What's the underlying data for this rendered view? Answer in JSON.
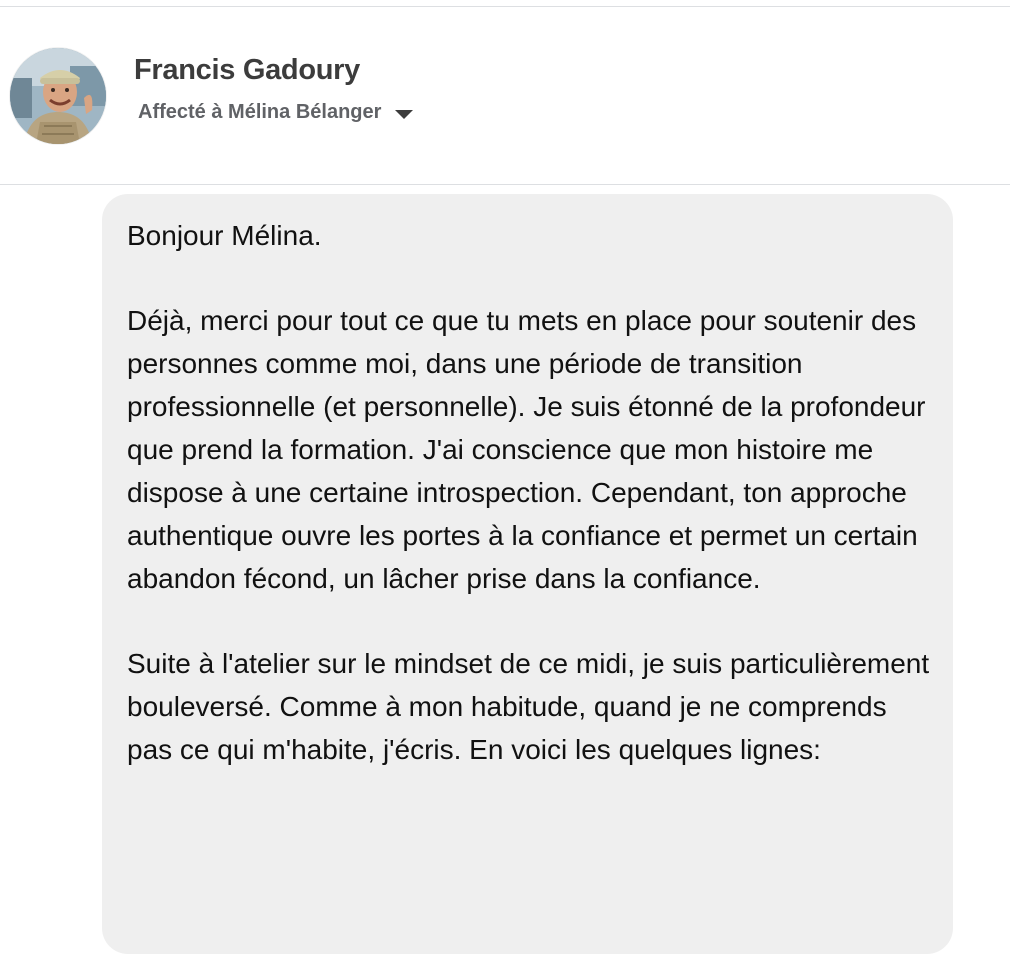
{
  "post": {
    "author_name": "Francis Gadoury",
    "assigned_label": "Affecté à Mélina Bélanger",
    "assignment_caret_icon": "caret-down-icon",
    "avatar_icon": "user-avatar-photo"
  },
  "message": {
    "greeting": "Bonjour Mélina.",
    "paragraph_1": "Déjà, merci pour tout ce que tu mets en place pour soutenir des personnes comme moi, dans une période de transition professionnelle (et personnelle). Je suis étonné de la profondeur que prend la formation. J'ai conscience que mon histoire me dispose à une certaine introspection. Cependant, ton approche authentique ouvre les portes à la confiance et permet un certain abandon fécond, un lâcher prise dans la confiance.",
    "paragraph_2": "Suite à l'atelier sur le mindset de ce midi, je suis particulièrement bouleversé. Comme à mon habitude, quand je ne comprends pas ce qui m'habite, j'écris. En voici les quelques lignes:"
  },
  "colors": {
    "bubble_background": "#efefef",
    "divider": "#dddfe2",
    "name_text": "#3c3c3c",
    "secondary_text": "#606266",
    "body_text": "#111111"
  }
}
